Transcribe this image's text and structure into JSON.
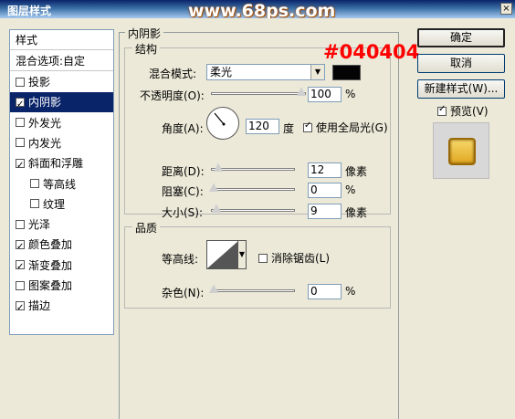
{
  "window": {
    "title": "图层样式",
    "watermark": "www.68ps.com",
    "close_glyph": "×"
  },
  "annotation": "#040404",
  "style_list": {
    "header": "样式",
    "blend_options": "混合选项:自定",
    "items": [
      {
        "label": "投影",
        "checked": false,
        "indent": false,
        "selected": false
      },
      {
        "label": "内阴影",
        "checked": true,
        "indent": false,
        "selected": true
      },
      {
        "label": "外发光",
        "checked": false,
        "indent": false,
        "selected": false
      },
      {
        "label": "内发光",
        "checked": false,
        "indent": false,
        "selected": false
      },
      {
        "label": "斜面和浮雕",
        "checked": true,
        "indent": false,
        "selected": false
      },
      {
        "label": "等高线",
        "checked": false,
        "indent": true,
        "selected": false
      },
      {
        "label": "纹理",
        "checked": false,
        "indent": true,
        "selected": false
      },
      {
        "label": "光泽",
        "checked": false,
        "indent": false,
        "selected": false
      },
      {
        "label": "颜色叠加",
        "checked": true,
        "indent": false,
        "selected": false
      },
      {
        "label": "渐变叠加",
        "checked": true,
        "indent": false,
        "selected": false
      },
      {
        "label": "图案叠加",
        "checked": false,
        "indent": false,
        "selected": false
      },
      {
        "label": "描边",
        "checked": true,
        "indent": false,
        "selected": false
      }
    ]
  },
  "inner_shadow": {
    "section_title": "内阴影",
    "structure": {
      "title": "结构",
      "blend_mode_label": "混合模式:",
      "blend_mode_value": "柔光",
      "shadow_color": "#040404",
      "opacity_label": "不透明度(O):",
      "opacity_value": "100",
      "opacity_unit": "%",
      "angle_label": "角度(A):",
      "angle_value": "120",
      "angle_unit": "度",
      "global_light_label": "使用全局光(G)",
      "global_light_checked": true,
      "distance_label": "距离(D):",
      "distance_value": "12",
      "distance_unit": "像素",
      "choke_label": "阻塞(C):",
      "choke_value": "0",
      "choke_unit": "%",
      "size_label": "大小(S):",
      "size_value": "9",
      "size_unit": "像素"
    },
    "quality": {
      "title": "品质",
      "contour_label": "等高线:",
      "antialias_label": "消除锯齿(L)",
      "antialias_checked": false,
      "noise_label": "杂色(N):",
      "noise_value": "0",
      "noise_unit": "%"
    }
  },
  "buttons": {
    "ok": "确定",
    "cancel": "取消",
    "new_style": "新建样式(W)...",
    "preview_label": "预览(V)",
    "preview_checked": true
  }
}
